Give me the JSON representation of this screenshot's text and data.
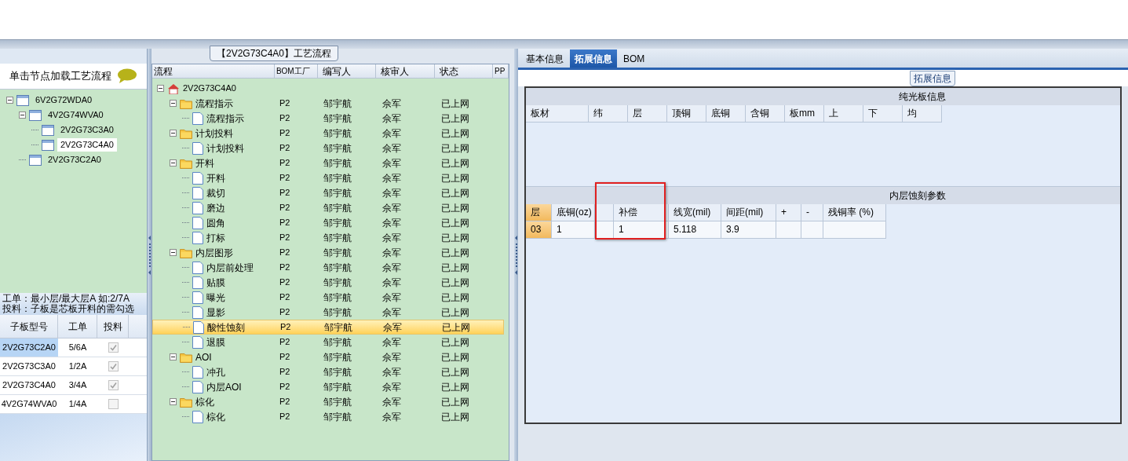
{
  "left_panel": {
    "title": "单击节点加载工艺流程",
    "tree": [
      {
        "label": "6V2G72WDA0",
        "expanded": true,
        "selected": false,
        "children": [
          {
            "label": "4V2G74WVA0",
            "expanded": true,
            "selected": false,
            "children": [
              {
                "label": "2V2G73C3A0",
                "selected": false
              },
              {
                "label": "2V2G73C4A0",
                "selected": true
              }
            ]
          },
          {
            "label": "2V2G73C2A0",
            "selected": false
          }
        ]
      }
    ],
    "hint_lines": [
      "工单：最小层/最大层A 如:2/7A",
      "投料：子板是芯板开料的需勾选"
    ],
    "table": {
      "columns": [
        "子板型号",
        "工单",
        "投料"
      ],
      "rows": [
        {
          "model": "2V2G73C2A0",
          "order": "5/6A",
          "checked": true,
          "selected": true
        },
        {
          "model": "2V2G73C3A0",
          "order": "1/2A",
          "checked": true,
          "selected": false
        },
        {
          "model": "2V2G73C4A0",
          "order": "3/4A",
          "checked": true,
          "selected": false
        },
        {
          "model": "4V2G74WVA0",
          "order": "1/4A",
          "checked": false,
          "selected": false
        }
      ]
    }
  },
  "process_panel": {
    "title": "【2V2G73C4A0】工艺流程",
    "columns": [
      "流程",
      "BOM工厂",
      "编写人",
      "核审人",
      "状态",
      "PP"
    ],
    "root": {
      "label": "2V2G73C4A0",
      "expanded": true,
      "children": [
        {
          "label": "流程指示",
          "factory": "P2",
          "writer": "邹宇航",
          "reviewer": "佘军",
          "status": "已上网",
          "expanded": true,
          "selected": false,
          "children": [
            {
              "label": "流程指示",
              "factory": "P2",
              "writer": "邹宇航",
              "reviewer": "佘军",
              "status": "已上网",
              "selected": false
            }
          ]
        },
        {
          "label": "计划投料",
          "factory": "P2",
          "writer": "邹宇航",
          "reviewer": "佘军",
          "status": "已上网",
          "expanded": true,
          "selected": false,
          "children": [
            {
              "label": "计划投料",
              "factory": "P2",
              "writer": "邹宇航",
              "reviewer": "佘军",
              "status": "已上网",
              "selected": false
            }
          ]
        },
        {
          "label": "开料",
          "factory": "P2",
          "writer": "邹宇航",
          "reviewer": "佘军",
          "status": "已上网",
          "expanded": true,
          "selected": false,
          "children": [
            {
              "label": "开料",
              "factory": "P2",
              "writer": "邹宇航",
              "reviewer": "佘军",
              "status": "已上网",
              "selected": false
            },
            {
              "label": "裁切",
              "factory": "P2",
              "writer": "邹宇航",
              "reviewer": "佘军",
              "status": "已上网",
              "selected": false
            },
            {
              "label": "磨边",
              "factory": "P2",
              "writer": "邹宇航",
              "reviewer": "佘军",
              "status": "已上网",
              "selected": false
            },
            {
              "label": "圆角",
              "factory": "P2",
              "writer": "邹宇航",
              "reviewer": "佘军",
              "status": "已上网",
              "selected": false
            },
            {
              "label": "打标",
              "factory": "P2",
              "writer": "邹宇航",
              "reviewer": "佘军",
              "status": "已上网",
              "selected": false
            }
          ]
        },
        {
          "label": "内层图形",
          "factory": "P2",
          "writer": "邹宇航",
          "reviewer": "佘军",
          "status": "已上网",
          "expanded": true,
          "selected": false,
          "children": [
            {
              "label": "内层前处理",
              "factory": "P2",
              "writer": "邹宇航",
              "reviewer": "佘军",
              "status": "已上网",
              "selected": false
            },
            {
              "label": "贴膜",
              "factory": "P2",
              "writer": "邹宇航",
              "reviewer": "佘军",
              "status": "已上网",
              "selected": false
            },
            {
              "label": "曝光",
              "factory": "P2",
              "writer": "邹宇航",
              "reviewer": "佘军",
              "status": "已上网",
              "selected": false
            },
            {
              "label": "显影",
              "factory": "P2",
              "writer": "邹宇航",
              "reviewer": "佘军",
              "status": "已上网",
              "selected": false
            },
            {
              "label": "酸性蚀刻",
              "factory": "P2",
              "writer": "邹宇航",
              "reviewer": "佘军",
              "status": "已上网",
              "selected": true
            },
            {
              "label": "退膜",
              "factory": "P2",
              "writer": "邹宇航",
              "reviewer": "佘军",
              "status": "已上网",
              "selected": false
            }
          ]
        },
        {
          "label": "AOI",
          "factory": "P2",
          "writer": "邹宇航",
          "reviewer": "佘军",
          "status": "已上网",
          "expanded": true,
          "selected": false,
          "children": [
            {
              "label": "冲孔",
              "factory": "P2",
              "writer": "邹宇航",
              "reviewer": "佘军",
              "status": "已上网",
              "selected": false
            },
            {
              "label": "内层AOI",
              "factory": "P2",
              "writer": "邹宇航",
              "reviewer": "佘军",
              "status": "已上网",
              "selected": false
            }
          ]
        },
        {
          "label": "棕化",
          "factory": "P2",
          "writer": "邹宇航",
          "reviewer": "佘军",
          "status": "已上网",
          "expanded": true,
          "selected": false,
          "children": [
            {
              "label": "棕化",
              "factory": "P2",
              "writer": "邹宇航",
              "reviewer": "佘军",
              "status": "已上网",
              "selected": false
            }
          ]
        }
      ]
    }
  },
  "detail_panel": {
    "tabs": [
      {
        "label": "基本信息",
        "selected": false
      },
      {
        "label": "拓展信息",
        "selected": true
      },
      {
        "label": "BOM",
        "selected": false
      }
    ],
    "section_title": "拓展信息",
    "plain_board": {
      "title": "纯光板信息",
      "columns": [
        "板材",
        "纬",
        "层",
        "顶铜",
        "底铜",
        "含铜",
        "板mm",
        "上",
        "下",
        "均"
      ]
    },
    "inner_etch": {
      "title": "内层蚀刻参数",
      "annotation": {
        "kind": "rectangle"
      },
      "columns": [
        {
          "header": "层",
          "value": "03",
          "kind": "row-header"
        },
        {
          "header": "底铜(oz)",
          "value": "1"
        },
        {},
        {
          "header": "补偿",
          "value": "1"
        },
        {
          "header": "线宽(mil)",
          "value": "5.118"
        },
        {
          "header": "间距(mil)",
          "value": "3.9"
        },
        {
          "header": "+"
        },
        {
          "header": "-"
        },
        {
          "header": "残铜率 (%)"
        }
      ]
    }
  }
}
